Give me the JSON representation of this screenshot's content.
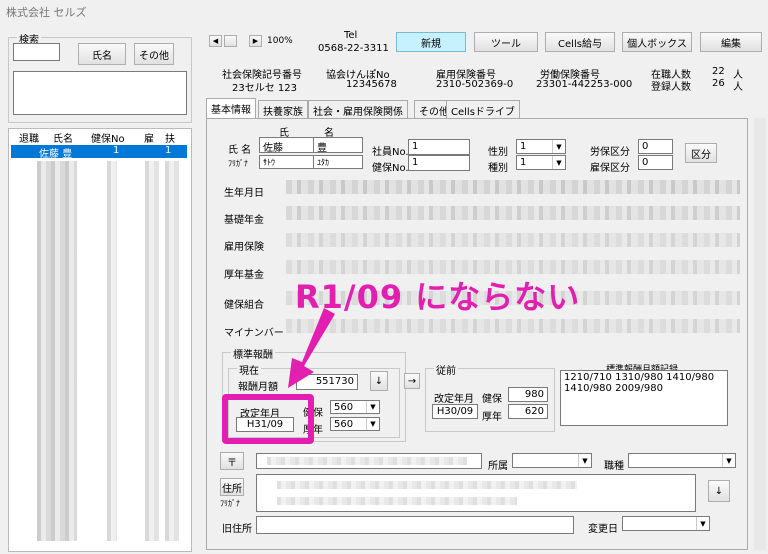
{
  "window": {
    "title": "株式会社 セルズ"
  },
  "search": {
    "title": "検索",
    "name_btn": "氏名",
    "other_btn": "その他"
  },
  "list": {
    "headers": [
      "退職",
      "氏名",
      "健保No",
      "雇",
      "扶"
    ],
    "selected": {
      "retired": "",
      "name": "佐藤 豊",
      "kenpo": "1",
      "koyo": "",
      "fuyo": "1"
    }
  },
  "toolbar": {
    "zoom": "100%",
    "tel_label": "Tel",
    "tel": "0568-22-3311",
    "new": "新規",
    "tool": "ツール",
    "cells_kyuyo": "Cells給与",
    "personal_box": "個人ボックス",
    "edit": "編集"
  },
  "info": {
    "shaho_label": "社会保険記号番号",
    "shaho_value": "23セルセ 123",
    "kyokai_label": "協会けんぽNo",
    "kyokai_value": "12345678",
    "koyo_label": "雇用保険番号",
    "koyo_value": "2310-502369-0",
    "rodo_label": "労働保険番号",
    "rodo_value": "23301-442253-000",
    "zaishoku_label": "在職人数",
    "zaishoku_value": "22",
    "zaishoku_unit": "人",
    "toroku_label": "登録人数",
    "toroku_value": "26",
    "toroku_unit": "人"
  },
  "tabs": [
    "基本情報",
    "扶養家族",
    "社会・雇用保険関係",
    "その他",
    "Cellsドライブ"
  ],
  "form": {
    "sei_label": "氏",
    "mei_label": "名",
    "name_label": "氏 名",
    "sei": "佐藤",
    "mei": "豊",
    "kana_label": "ﾌﾘｶﾞﾅ",
    "sei_kana": "ｻﾄｳ",
    "mei_kana": "ﾕﾀｶ",
    "shain_label": "社員No.",
    "shain": "1",
    "kenpo_label": "健保No.",
    "kenpo": "1",
    "seibetsu_label": "性別",
    "seibetsu": "1",
    "shubetsu_label": "種別",
    "shubetsu": "1",
    "rouho_label": "労保区分",
    "rouho": "0",
    "koho_label": "雇保区分",
    "koho": "0",
    "kubun_btn": "区分",
    "birth_label": "生年月日",
    "kiso_label": "基礎年金",
    "koyo_label": "雇用保険",
    "kosei_label": "厚年基金",
    "kenpo_kumiai_label": "健保組合",
    "mynumber_label": "マイナンバー"
  },
  "hyojun": {
    "group": "標準報酬",
    "current": "現在",
    "gekkan_label": "報酬月額",
    "gekkan": "551730",
    "kaitei_label": "改定年月",
    "kaitei": "H31/09",
    "kenpo_label": "健保",
    "kenpo": "560",
    "kosei_label": "厚年",
    "kosei": "560",
    "arrow_down": "↓",
    "arrow_right": "→"
  },
  "prev": {
    "group": "従前",
    "kaitei_label": "改定年月",
    "kaitei": "H30/09",
    "kenpo_label": "健保",
    "kenpo": "980",
    "kosei_label": "厚年",
    "kosei": "620"
  },
  "history": {
    "title": "標準報酬月額記録",
    "line1": "1210/710 1310/980 1410/980",
    "line2": "1410/980 2009/980"
  },
  "annotation": {
    "text": "R1/09 にならない"
  },
  "address": {
    "zip_btn": "〒",
    "shozoku_label": "所属",
    "shokushu_label": "職種",
    "jusho_btn": "住所",
    "kana_label": "ﾌﾘｶﾞﾅ",
    "down": "↓",
    "kyu_label": "旧住所",
    "henko_label": "変更日"
  },
  "colors": {
    "highlight": "#e21fb0",
    "selected_row": "#0078d7"
  }
}
